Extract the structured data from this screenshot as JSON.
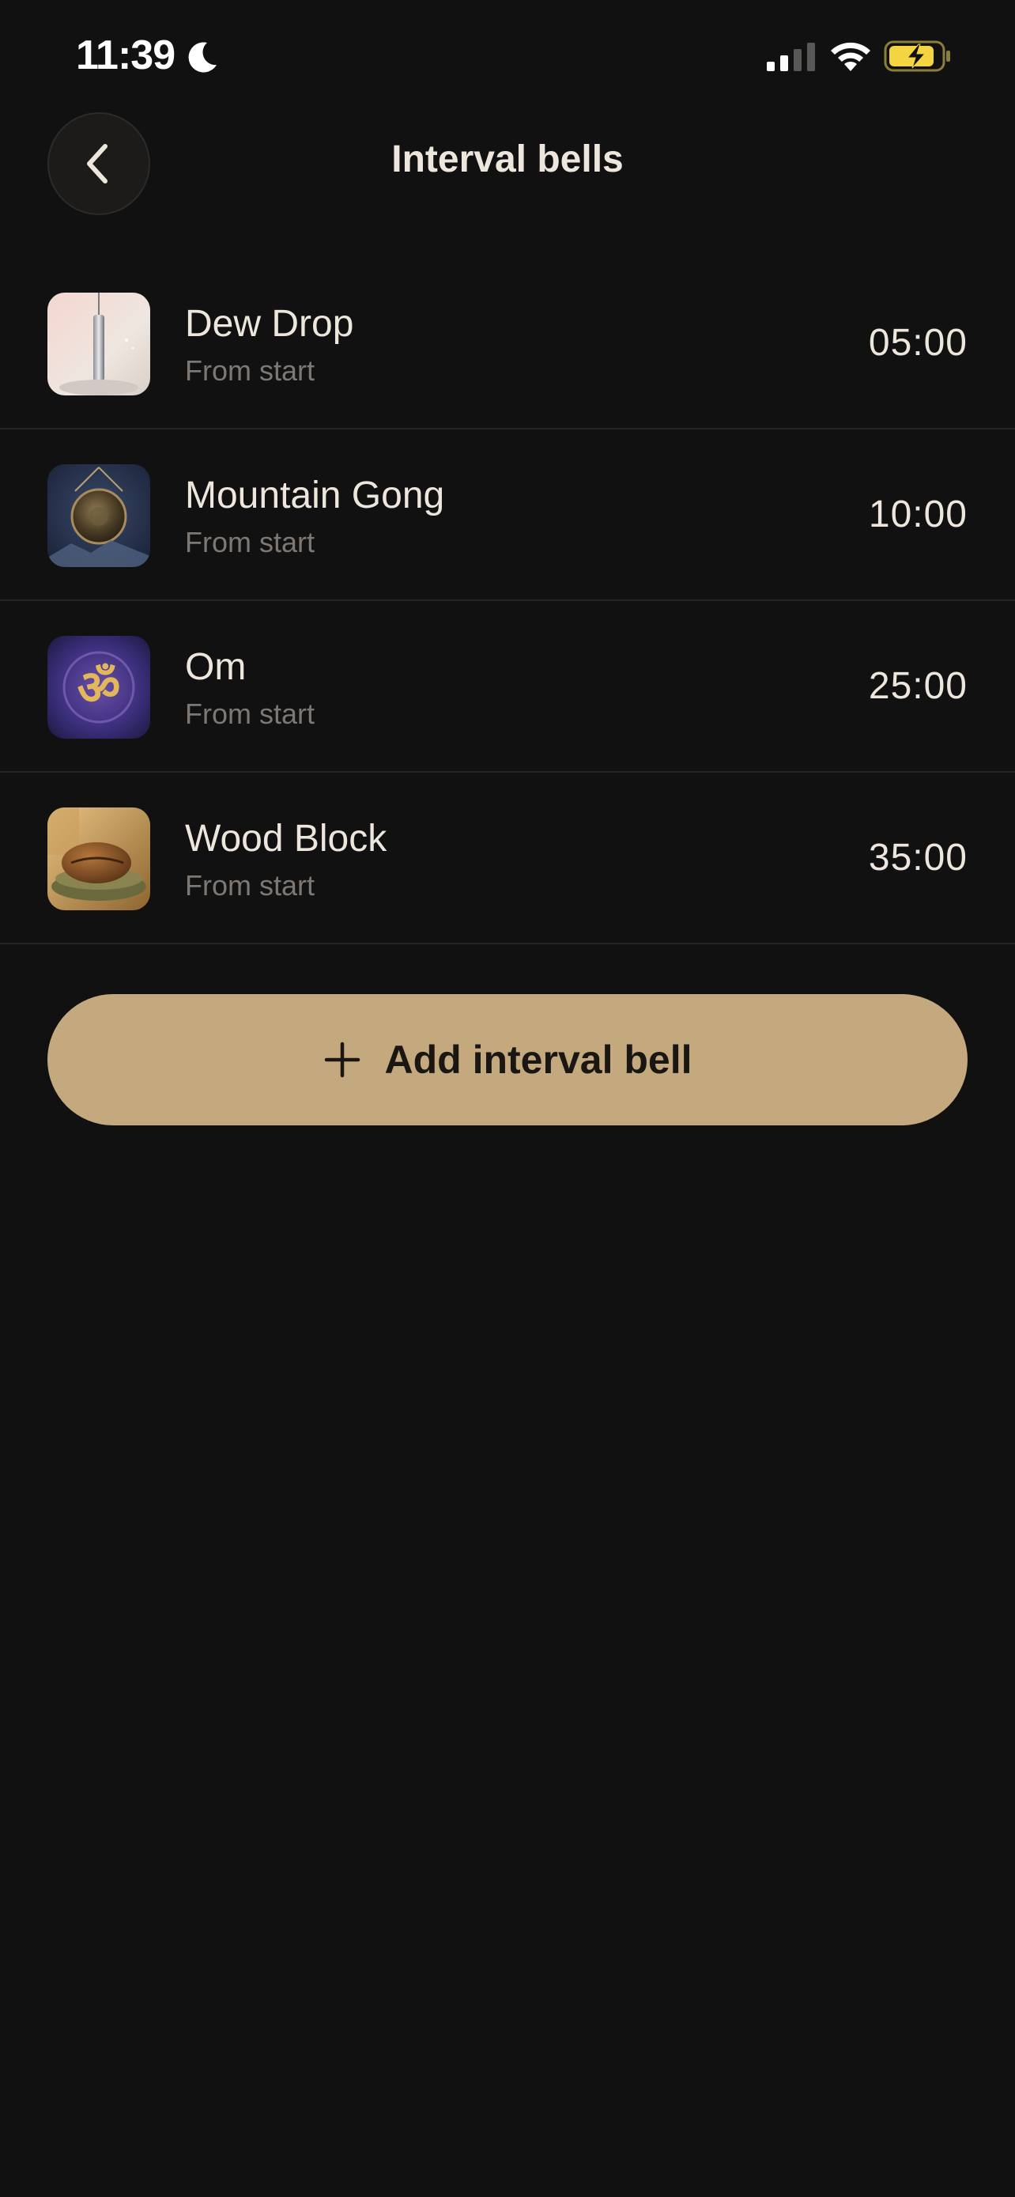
{
  "status_bar": {
    "time": "11:39"
  },
  "header": {
    "title": "Interval bells"
  },
  "bells": [
    {
      "name": "Dew Drop",
      "subtitle": "From start",
      "time": "05:00",
      "icon": "dew-drop-chime"
    },
    {
      "name": "Mountain Gong",
      "subtitle": "From start",
      "time": "10:00",
      "icon": "gong"
    },
    {
      "name": "Om",
      "subtitle": "From start",
      "time": "25:00",
      "icon": "om-symbol"
    },
    {
      "name": "Wood Block",
      "subtitle": "From start",
      "time": "35:00",
      "icon": "wood-block"
    }
  ],
  "add_button": {
    "label": "Add interval bell",
    "color": "#C4A97F"
  },
  "colors": {
    "background": "#121111",
    "text": "#ECE6DD",
    "subtext": "#7D7873",
    "accent": "#C4A97F",
    "battery": "#F5D442"
  }
}
